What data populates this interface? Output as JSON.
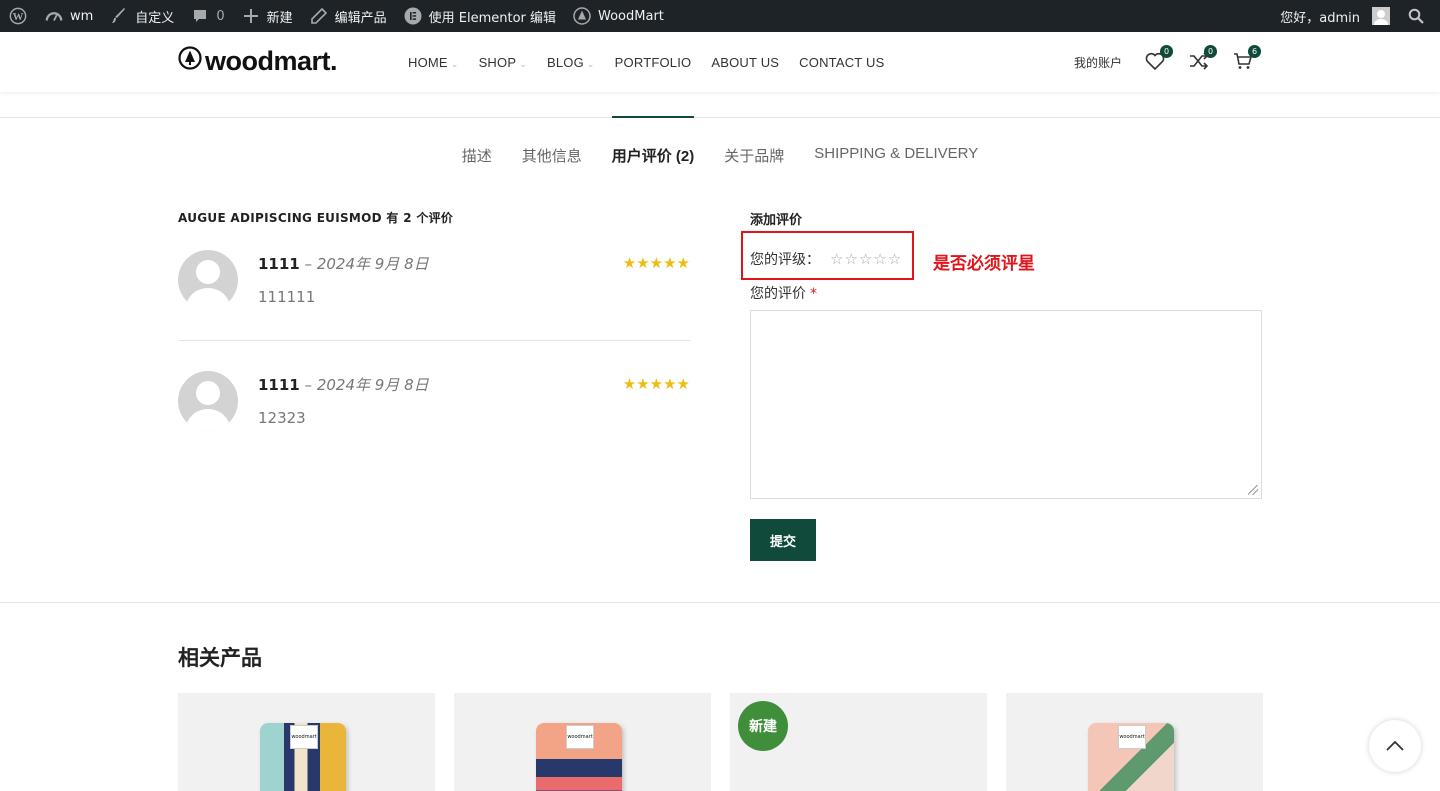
{
  "admin_bar": {
    "site": "wm",
    "customize": "自定义",
    "comments": "0",
    "new": "新建",
    "edit_product": "编辑产品",
    "elementor": "使用 Elementor 编辑",
    "woodmart": "WoodMart",
    "greeting": "您好，admin"
  },
  "header": {
    "logo": "woodmart.",
    "nav": [
      "HOME",
      "SHOP",
      "BLOG",
      "PORTFOLIO",
      "ABOUT US",
      "CONTACT US"
    ],
    "account": "我的账户",
    "wishlist_count": "0",
    "compare_count": "0",
    "cart_count": "6"
  },
  "tabs": [
    "描述",
    "其他信息",
    "用户评价 (2)",
    "关于品牌",
    "SHIPPING & DELIVERY"
  ],
  "reviews": {
    "title": "AUGUE ADIPISCING EUISMOD 有 2 个评价",
    "items": [
      {
        "author": "1111",
        "date": "2024年 9月 8日",
        "text": "111111",
        "rating": 5,
        "stars": "★★★★★"
      },
      {
        "author": "1111",
        "date": "2024年 9月 8日",
        "text": "12323",
        "rating": 5,
        "stars": "★★★★★"
      }
    ]
  },
  "form": {
    "title": "添加评价",
    "rating_label": "您的评级：",
    "rating_stars": "☆☆☆☆☆",
    "annotation": "是否必须评星",
    "review_label": "您的评价",
    "required_mark": "*",
    "submit": "提交"
  },
  "related": {
    "title": "相关产品",
    "new_badge": "新建",
    "brand_label": "woodmart"
  },
  "colors": {
    "accent": "#0f4a3a",
    "star": "#eabe12",
    "annotation_red": "#e1141a",
    "new_badge": "#3f8f3a"
  }
}
